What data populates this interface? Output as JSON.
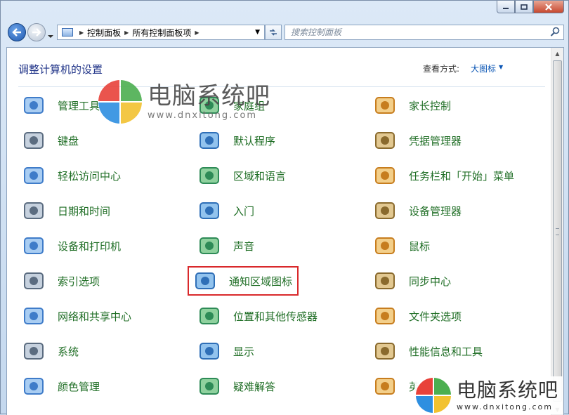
{
  "window": {
    "caption_buttons": [
      "minimize",
      "maximize",
      "close"
    ]
  },
  "toolbar": {
    "breadcrumb": [
      "控制面板",
      "所有控制面板项"
    ],
    "search_placeholder": "搜索控制面板"
  },
  "header": {
    "title": "调整计算机的设置",
    "view_label": "查看方式:",
    "view_value": "大图标"
  },
  "items": [
    {
      "label": "管理工具",
      "icon": "admin-tools-icon"
    },
    {
      "label": "家庭组",
      "icon": "homegroup-icon"
    },
    {
      "label": "家长控制",
      "icon": "parental-controls-icon"
    },
    {
      "label": "键盘",
      "icon": "keyboard-icon"
    },
    {
      "label": "默认程序",
      "icon": "default-programs-icon"
    },
    {
      "label": "凭据管理器",
      "icon": "credential-manager-icon"
    },
    {
      "label": "轻松访问中心",
      "icon": "ease-of-access-icon"
    },
    {
      "label": "区域和语言",
      "icon": "region-language-icon"
    },
    {
      "label": "任务栏和「开始」菜单",
      "icon": "taskbar-start-menu-icon"
    },
    {
      "label": "日期和时间",
      "icon": "date-time-icon"
    },
    {
      "label": "入门",
      "icon": "getting-started-icon"
    },
    {
      "label": "设备管理器",
      "icon": "device-manager-icon"
    },
    {
      "label": "设备和打印机",
      "icon": "devices-printers-icon"
    },
    {
      "label": "声音",
      "icon": "sound-icon"
    },
    {
      "label": "鼠标",
      "icon": "mouse-icon"
    },
    {
      "label": "索引选项",
      "icon": "indexing-options-icon"
    },
    {
      "label": "通知区域图标",
      "icon": "notification-area-icons-icon",
      "highlighted": true
    },
    {
      "label": "同步中心",
      "icon": "sync-center-icon"
    },
    {
      "label": "网络和共享中心",
      "icon": "network-sharing-icon"
    },
    {
      "label": "位置和其他传感器",
      "icon": "location-sensors-icon"
    },
    {
      "label": "文件夹选项",
      "icon": "folder-options-icon"
    },
    {
      "label": "系统",
      "icon": "system-icon"
    },
    {
      "label": "显示",
      "icon": "display-icon"
    },
    {
      "label": "性能信息和工具",
      "icon": "performance-tools-icon"
    },
    {
      "label": "颜色管理",
      "icon": "color-management-icon"
    },
    {
      "label": "疑难解答",
      "icon": "troubleshooting-icon"
    },
    {
      "label": "英",
      "icon": "intel-graphics-icon"
    }
  ],
  "watermark": {
    "title": "电脑系统吧",
    "url": "www.dnxitong.com",
    "logo_colors": [
      "#e8423a",
      "#4caf50",
      "#2e8fe0",
      "#f2c230"
    ]
  }
}
